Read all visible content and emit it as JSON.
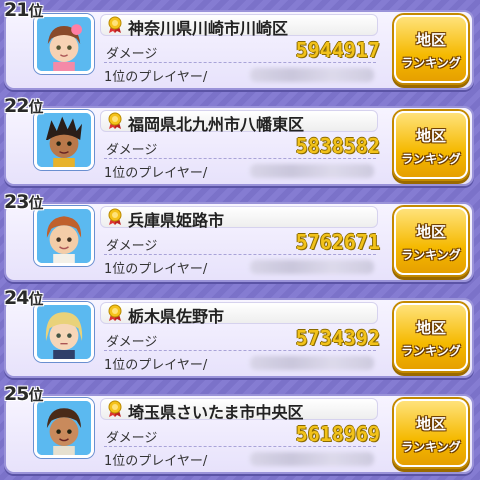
{
  "labels": {
    "damage": "ダメージ",
    "player_prefix": "1位のプレイヤー/",
    "rank_suffix": "位",
    "button_line1": "地区",
    "button_line2": "ランキング"
  },
  "colors": {
    "background": "#7b72c9",
    "damage_value": "#f2c21a",
    "button": "#f5b900"
  },
  "rows": [
    {
      "rank": "21",
      "area": "神奈川県川崎市川崎区",
      "damage": "5944917",
      "avatar_icon": "girl-brown-hair-bow-icon"
    },
    {
      "rank": "22",
      "area": "福岡県北九州市八幡東区",
      "damage": "5838582",
      "avatar_icon": "boy-dark-spiky-hair-icon"
    },
    {
      "rank": "23",
      "area": "兵庫県姫路市",
      "damage": "5762671",
      "avatar_icon": "boy-brown-hair-icon"
    },
    {
      "rank": "24",
      "area": "栃木県佐野市",
      "damage": "5734392",
      "avatar_icon": "blonde-hair-icon"
    },
    {
      "rank": "25",
      "area": "埼玉県さいたま市中央区",
      "damage": "5618969",
      "avatar_icon": "boy-tan-skin-icon"
    }
  ]
}
